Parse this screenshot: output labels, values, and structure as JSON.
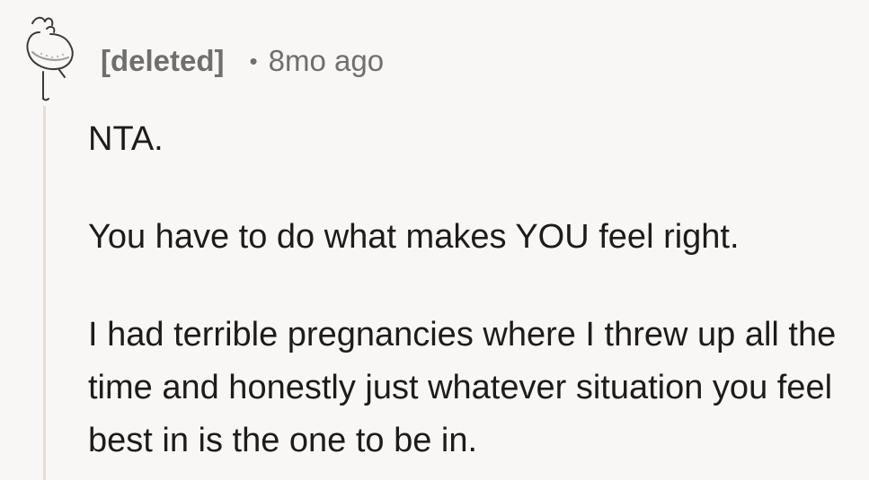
{
  "comment": {
    "author": "[deleted]",
    "separator": "•",
    "timestamp": "8mo ago",
    "paragraphs": [
      "NTA.",
      "You have to do what makes YOU feel right.",
      "I had terrible pregnancies where I threw up all the time and honestly just whatever situation you feel best in is the one to be in."
    ]
  },
  "avatar": {
    "icon": "snoo-avatar-icon"
  }
}
